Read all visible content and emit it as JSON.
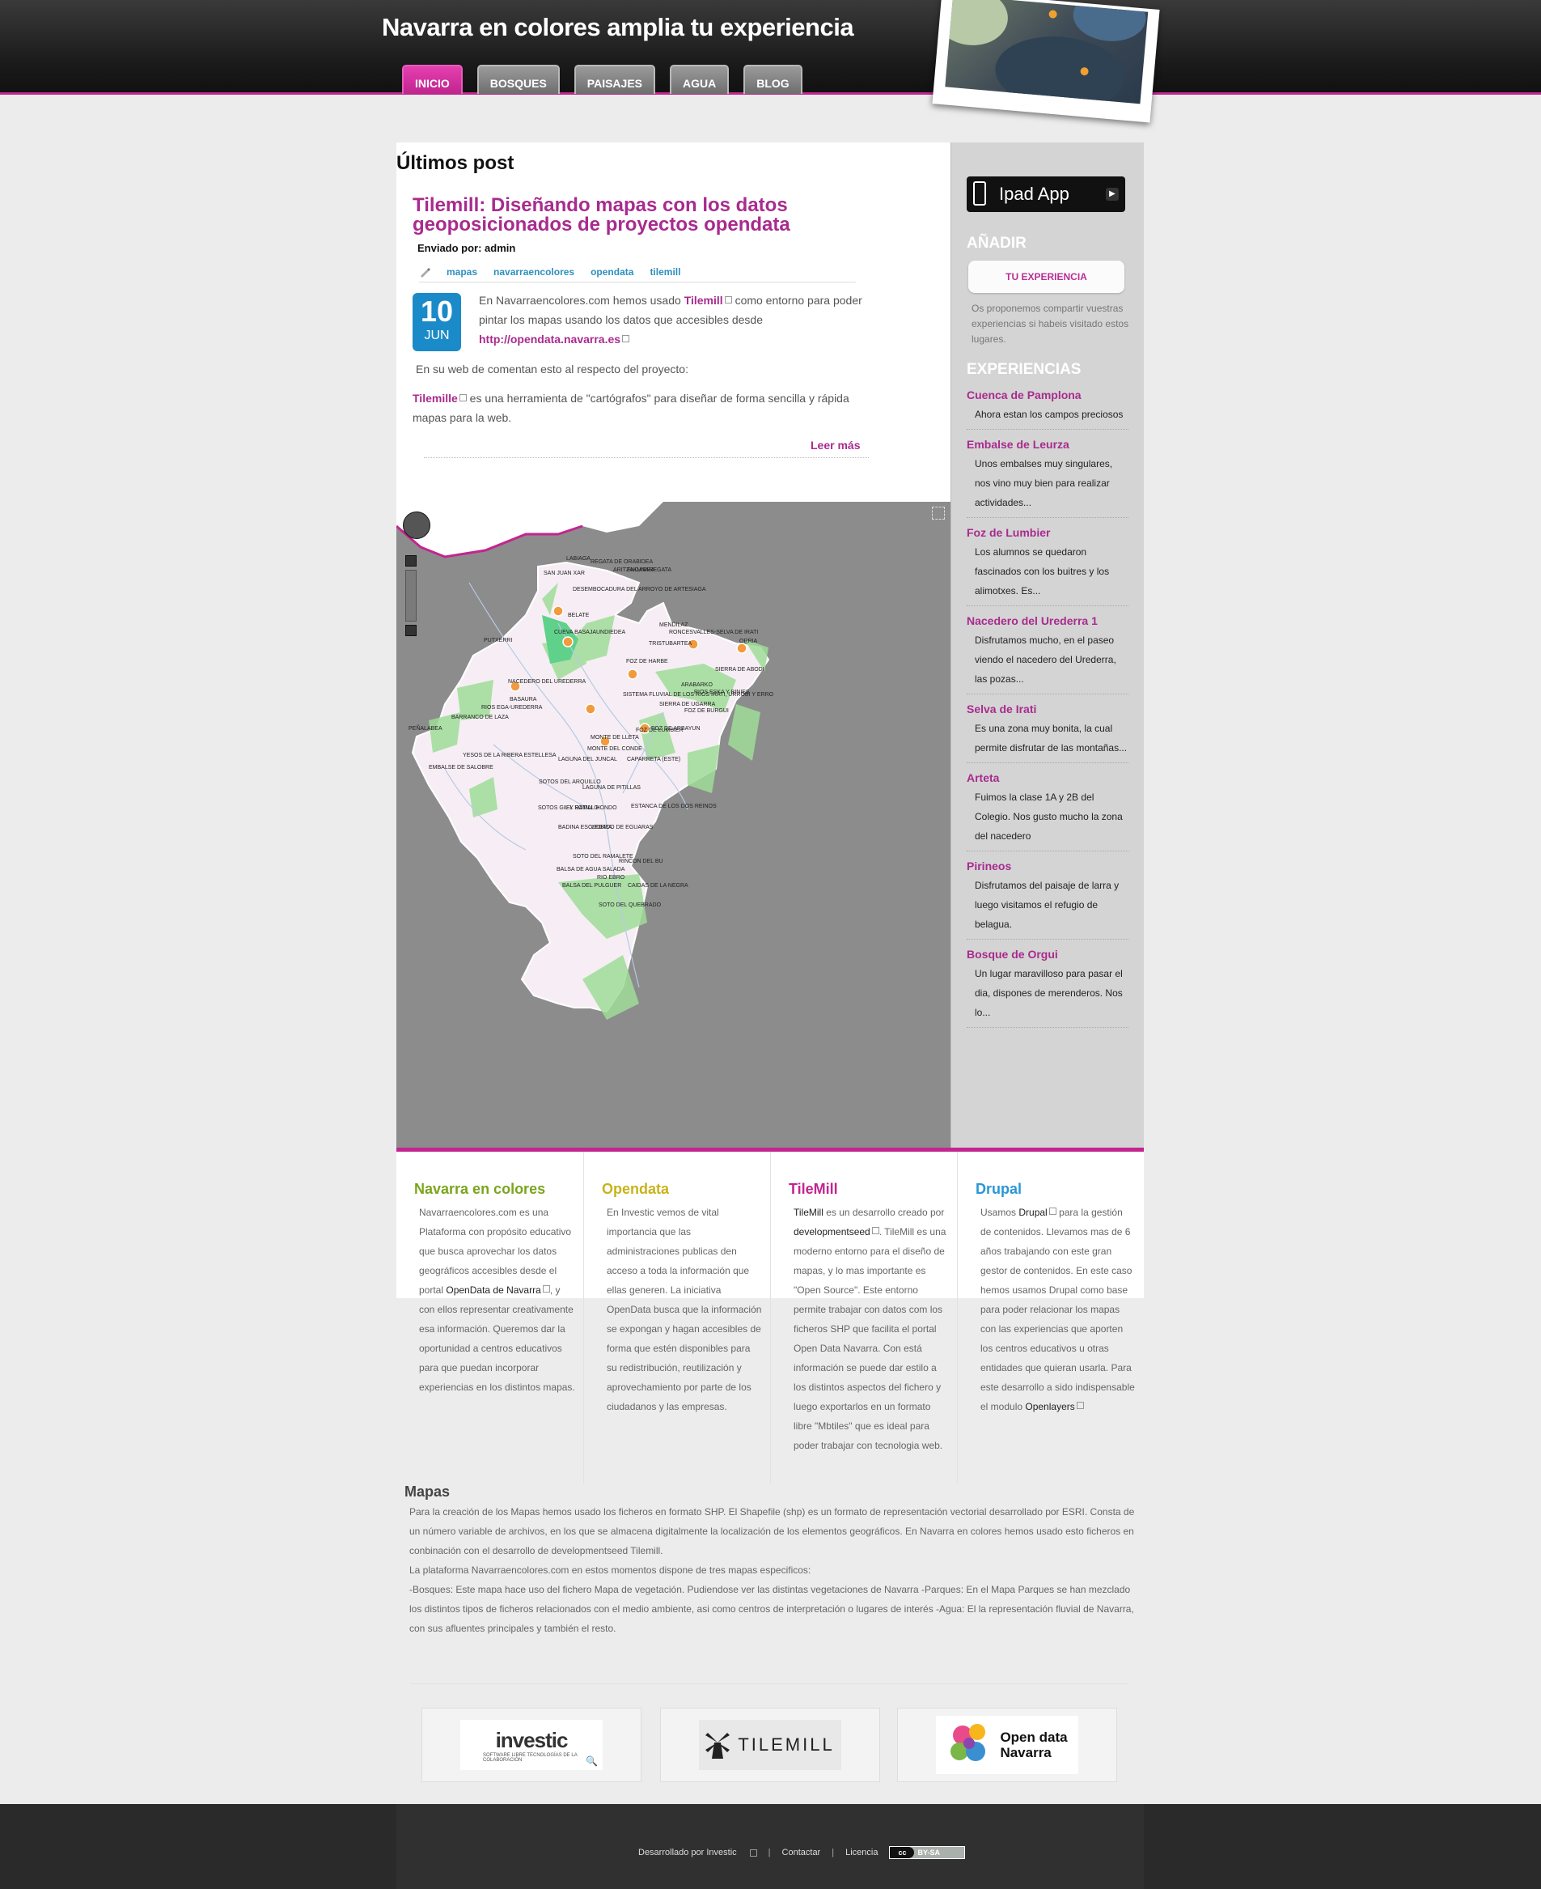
{
  "header": {
    "site_title": "Navarra en colores amplia tu experiencia",
    "nav": [
      "INICIO",
      "BOSQUES",
      "PAISAJES",
      "AGUA",
      "BLOG"
    ],
    "active_tab": "INICIO"
  },
  "main": {
    "section_heading": "Últimos post",
    "post": {
      "title": "Tilemill: Diseñando mapas con los datos geoposicionados de proyectos opendata",
      "author": "Enviado por: admin",
      "tags": [
        "mapas",
        "navarraencolores",
        "opendata",
        "tilemill"
      ],
      "date_day": "10",
      "date_month": "JUN",
      "p1_before": "En Navarraencolores.com hemos usado",
      "p1_link": "Tilemill",
      "p1_after": "como entorno para poder pintar los mapas usando los datos que accesibles desde",
      "p1_url": "http://opendata.navarra.es",
      "p2": "En su web de comentan esto al respecto del proyecto:",
      "p3_link": "Tilemille",
      "p3_after": "es una herramienta de \"cartógrafos\" para diseñar de forma sencilla y rápida mapas para la web.",
      "read_more": "Leer más"
    }
  },
  "map": {
    "labels": [
      "LABIAGA",
      "REGATA DE ORABIDEA",
      "ARITZAKUNAREGATA",
      "ENDARRA",
      "SAN JUAN XAR",
      "DESEMBOCADURA DEL ARROYO DE ARTESIAGA",
      "BELATE",
      "CUEVA BASAJAUNDIEDEA",
      "PUTXERRI",
      "MENDILAZ",
      "RONCESVALLES-SELVA DE IRATI",
      "TRISTUBARTEA",
      "FOZ DE HARBE",
      "ORRIA",
      "SIERRA DE ABODI",
      "FOZ DE ARBAYUN",
      "NACEDERO DEL UREDERRA",
      "BASAURA",
      "RIOS EGA-UREDERRA",
      "BARRANCO DE LAZA",
      "PEÑALABEA",
      "SISTEMA FLUVIAL DE LOS RIOS IRATI, URROBI Y ERRO",
      "SIERRA DE UGARRA",
      "RIOS ESKA Y BINIES",
      "FOZ DE BURGUI",
      "FOZ DE LUMBIER",
      "MONTE DEL CONDE",
      "MONTE DE LLETA",
      "YESOS DE LA RIBERA ESTELLESA",
      "EMBALSE DE SALOBRE",
      "LAGUNA DEL JUNCAL",
      "CAPARRETA (ESTE)",
      "SOTOS DEL ARQUILLO",
      "LAGUNA DE PITILLAS",
      "SOTOS GIL Y RAMAL HONDO",
      "EL SOTILLO",
      "ESTANCA DE LOS DOS REINOS",
      "BADINA ESCUDERA",
      "VEDADO DE EGUARAS",
      "SOTO DEL RAMALETE",
      "BALSA DE AGUA SALADA",
      "RINCON DEL BU",
      "RIO EBRO",
      "BALSA DEL PULGUER",
      "CAIDAS DE LA NEGRA",
      "SOTO DEL QUEBRADO"
    ]
  },
  "sidebar": {
    "ipad_app": "Ipad App",
    "add_heading": "AÑADIR",
    "add_button": "TU EXPERIENCIA",
    "intro": "Os proponemos compartir vuestras experiencias si habeis visitado estos lugares.",
    "exp_heading": "EXPERIENCIAS",
    "experiences": [
      {
        "title": "Cuenca de Pamplona",
        "desc": "Ahora estan los campos preciosos"
      },
      {
        "title": "Embalse de Leurza",
        "desc": "Unos embalses muy singulares, nos vino muy bien para realizar actividades..."
      },
      {
        "title": "Foz de Lumbier",
        "desc": "Los alumnos se quedaron fascinados con los buitres y los alimotxes. Es..."
      },
      {
        "title": "Nacedero del Urederra 1",
        "desc": "Disfrutamos mucho, en el paseo viendo el nacedero del Urederra, las pozas..."
      },
      {
        "title": "Selva de Irati",
        "desc": "Es una zona muy bonita, la cual permite disfrutar de las montañas..."
      },
      {
        "title": "Arteta",
        "desc": "Fuimos la clase 1A y 2B del Colegio. Nos gusto mucho la zona del nacedero"
      },
      {
        "title": "Pirineos",
        "desc": "Disfrutamos del paisaje de larra y luego visitamos el refugio de belagua."
      },
      {
        "title": "Bosque de Orgui",
        "desc": "Un lugar maravilloso para pasar el dia, dispones de merenderos. Nos lo..."
      }
    ]
  },
  "footer_cols": [
    {
      "title": "Navarra en colores",
      "color": "#7aa51c",
      "text_before": "Navarraencolores.com es una Plataforma con propósito educativo que busca aprovechar los datos geográficos accesibles desde el portal",
      "link": "OpenData de Navarra",
      "text_after": ", y con ellos representar creativamente esa información. Queremos dar la oportunidad a centros educativos para que puedan incorporar experiencias en los distintos mapas."
    },
    {
      "title": "Opendata",
      "color": "#c9b31a",
      "text_before": "En Investic vemos de vital importancia que las administraciones publicas den acceso a toda la información que ellas generen. La iniciativa OpenData busca que la información se expongan y hagan accesibles de forma que estén disponibles para su redistribución, reutilización y aprovechamiento por parte de los ciudadanos y las empresas.",
      "link": "",
      "text_after": ""
    },
    {
      "title": "TileMill",
      "color": "#c3258f",
      "text_before": "",
      "link": "TileMill",
      "mid": "es un desarrollo creado por",
      "link2": "developmentseed",
      "text_after": ". TileMill es una moderno entorno para el diseño de mapas, y lo mas importante es \"Open Source\". Este entorno permite trabajar con datos com los ficheros SHP que facilita el portal Open Data Navarra. Con está información se puede dar estilo a los distintos aspectos del fichero y luego exportarlos en un formato libre \"Mbtiles\" que es ideal para poder trabajar con tecnologia web."
    },
    {
      "title": "Drupal",
      "color": "#2a97d6",
      "text_before": "Usamos",
      "link": "Drupal",
      "mid": "para la gestión de contenidos. Llevamos mas de 6 años trabajando con este gran gestor de contenidos. En este caso hemos usamos Drupal como base para poder relacionar los mapas con las experiencias que aporten los centros educativos u otras entidades que quieran usarla. Para este desarrollo a sido indispensable el modulo",
      "link2": "Openlayers",
      "text_after": ""
    }
  ],
  "mapas": {
    "title": "Mapas",
    "p1": "Para la creación de los Mapas hemos usado los ficheros en formato SHP. El Shapefile (shp) es un formato de representación vectorial desarrollado por ESRI. Consta de un número variable de archivos, en los que se almacena digitalmente la localización de los elementos geográficos. En Navarra en colores hemos usado esto ficheros en conbinación con el desarrollo de developmentseed Tilemill.",
    "p2": "La plataforma Navarraencolores.com en estos momentos dispone de tres mapas especificos:",
    "p3": "-Bosques: Este mapa hace uso del fichero Mapa de vegetación. Pudiendose ver las distintas vegetaciones de Navarra -Parques: En el Mapa Parques se han mezclado los distintos tipos de ficheros relacionados con el medio ambiente, asi como centros de interpretación o lugares de interés -Agua: El la representación fluvial de Navarra, con sus afluentes principales y también el resto."
  },
  "logos": {
    "investic": "investic",
    "investic_sub": "SOFTWARE LIBRE TECNOLOGÍAS DE LA COLABORACIÓN",
    "tilemill": "TILEMILL",
    "opendata_1": "Open data",
    "opendata_2": "Navarra"
  },
  "site_footer": {
    "developed": "Desarrollado por Investic",
    "contact": "Contactar",
    "license": "Licencia",
    "cc_left": "cc",
    "cc_right": "BY-SA"
  }
}
